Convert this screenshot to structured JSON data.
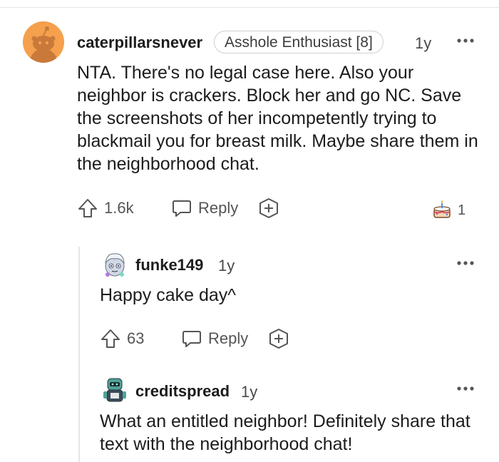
{
  "comments": [
    {
      "username": "caterpillarsnever",
      "flair": "Asshole Enthusiast [8]",
      "age": "1y",
      "body": "NTA. There's no legal case here. Also your neighbor is crackers. Block her and go NC. Save the screenshots of her incompetently trying to blackmail you for breast milk. Maybe share them in the neighborhood chat.",
      "votes": "1.6k",
      "reply_label": "Reply",
      "award_count": "1",
      "award_icon": "cake-award-icon",
      "avatar_icon": "snoo-avatar-icon",
      "avatar_color": "#f5a04d"
    },
    {
      "username": "funke149",
      "age": "1y",
      "body": "Happy cake day^",
      "votes": "63",
      "reply_label": "Reply",
      "avatar_icon": "custom-avatar-icon"
    },
    {
      "username": "creditspread",
      "age": "1y",
      "body": "What an entitled neighbor! Definitely share that text with the neighborhood chat!",
      "avatar_icon": "custom-avatar-icon"
    }
  ],
  "more_icon": "ellipsis-icon",
  "upvote_icon": "upvote-arrow-icon",
  "reply_icon": "speech-bubble-icon",
  "add_award_icon": "plus-award-icon"
}
